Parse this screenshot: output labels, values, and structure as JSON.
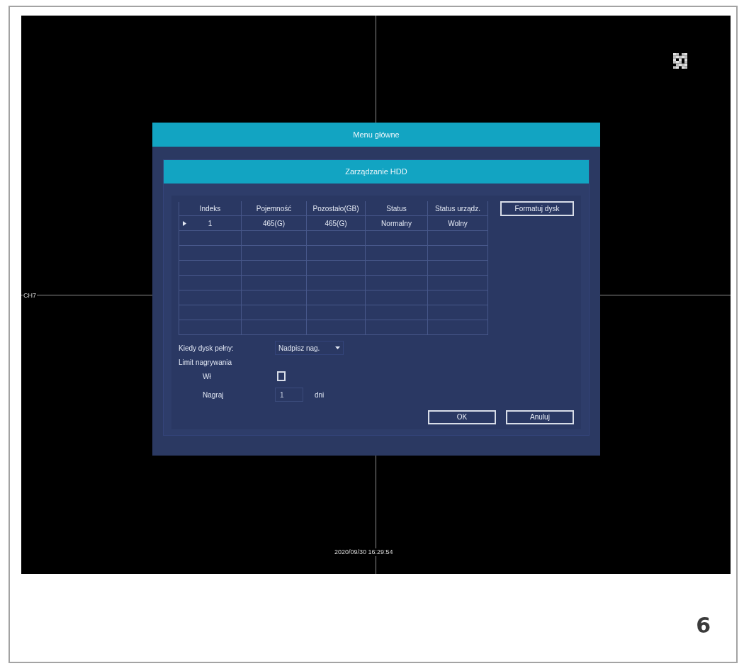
{
  "screen": {
    "channel_label": "CH7",
    "timestamp": "2020/09/30 16:29:54"
  },
  "dialog": {
    "title": "Menu główne",
    "panel_title": "Zarządzanie HDD",
    "table": {
      "columns": [
        "Indeks",
        "Pojemność",
        "Pozostało(GB)",
        "Status",
        "Status urządz."
      ],
      "rows": [
        {
          "selected": true,
          "cells": [
            "1",
            "465(G)",
            "465(G)",
            "Normalny",
            "Wolny"
          ]
        }
      ]
    },
    "format_button": "Formatuj dysk",
    "disk_full": {
      "label": "Kiedy dysk pełny:",
      "value": "Nadpisz nag."
    },
    "record_limit": {
      "label": "Limit nagrywania",
      "enable": {
        "label": "Wł",
        "checked": false
      },
      "record": {
        "label": "Nagraj",
        "value": "1",
        "unit": "dni"
      }
    },
    "buttons": [
      "OK",
      "Anuluj"
    ]
  },
  "page_number": "6"
}
